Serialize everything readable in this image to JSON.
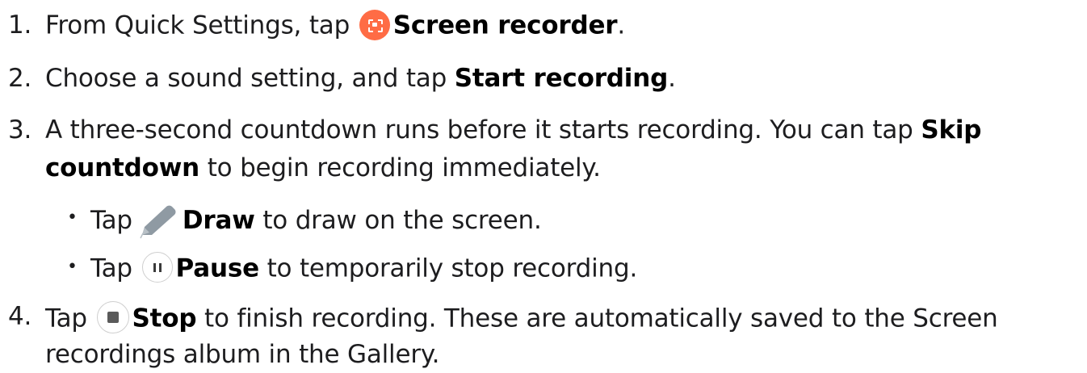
{
  "steps": [
    {
      "number": "1.",
      "pre": "From Quick Settings, tap",
      "icon": "screen-recorder-icon",
      "bold": "Screen recorder",
      "post": "."
    },
    {
      "number": "2.",
      "pre": "Choose a sound setting, and tap",
      "bold": "Start recording",
      "post": "."
    },
    {
      "number": "3.",
      "pre": "A three-second countdown runs before it starts recording. You can tap",
      "bold_a": "Skip",
      "bold_b": "countdown",
      "post": "to begin recording immediately.",
      "bullets": [
        {
          "symbol": "•",
          "pre": "Tap",
          "icon": "draw-pencil-icon",
          "bold": "Draw",
          "post": "to draw on the screen."
        },
        {
          "symbol": "•",
          "pre": "Tap",
          "icon": "pause-icon",
          "bold": "Pause",
          "post": "to temporarily stop recording."
        }
      ]
    },
    {
      "number": "4.",
      "pre": "Tap",
      "icon": "stop-icon",
      "bold": "Stop",
      "post": "to finish recording. These are automatically saved to the Screen",
      "post_cont": "recordings album in the Gallery."
    }
  ],
  "colors": {
    "text": "#1d1d1f",
    "recorder_icon_bg": "#ff6c45",
    "draw_icon": "#8f9aa3"
  }
}
